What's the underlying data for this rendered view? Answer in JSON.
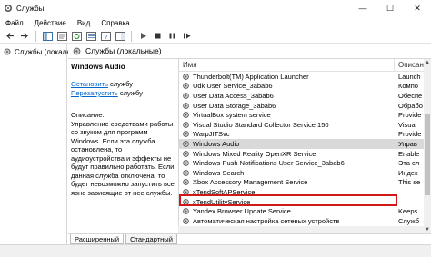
{
  "window": {
    "title": "Службы",
    "minimize": "—",
    "maximize": "☐",
    "close": "✕"
  },
  "menu": [
    "Файл",
    "Действие",
    "Вид",
    "Справка"
  ],
  "tree": {
    "root_label": "Службы (локальны"
  },
  "header": {
    "title": "Службы (локальные)"
  },
  "detail": {
    "service_name": "Windows Audio",
    "stop_link": "Остановить",
    "stop_suffix": " службу",
    "restart_link": "Перезапустить",
    "restart_suffix": " службу",
    "desc_label": "Описание:",
    "desc_text": "Управление средствами работы со звуком для программ Windows. Если эта служба остановлена, то аудиоустройства и эффекты не будут правильно работать. Если данная служба отключена, то будет невозможно запустить все явно зависящие от нее службы."
  },
  "columns": {
    "name": "Имя",
    "desc": "Описан"
  },
  "rows": [
    {
      "name": "Thunderbolt(TM) Application Launcher",
      "desc": "Launch"
    },
    {
      "name": "Udk User Service_3abab6",
      "desc": "Компо"
    },
    {
      "name": "User Data Access_3abab6",
      "desc": "Обеспе"
    },
    {
      "name": "User Data Storage_3abab6",
      "desc": "Обрабо"
    },
    {
      "name": "VirtualBox system service",
      "desc": "Provide"
    },
    {
      "name": "Visual Studio Standard Collector Service 150",
      "desc": "Visual"
    },
    {
      "name": "WarpJITSvc",
      "desc": "Provide"
    },
    {
      "name": "Windows Audio",
      "desc": "Управ"
    },
    {
      "name": "Windows Mixed Reality OpenXR Service",
      "desc": "Enable"
    },
    {
      "name": "Windows Push Notifications User Service_3abab6",
      "desc": "Эта сл"
    },
    {
      "name": "Windows Search",
      "desc": "Индек"
    },
    {
      "name": "Xbox Accessory Management Service",
      "desc": "This se"
    },
    {
      "name": "xTendSoftAPService",
      "desc": ""
    },
    {
      "name": "xTendUtilityService",
      "desc": ""
    },
    {
      "name": "Yandex.Browser Update Service",
      "desc": "Keeps"
    },
    {
      "name": "Автоматическая настройка сетевых устройств",
      "desc": "Служб"
    }
  ],
  "selected_index": 7,
  "tabs": {
    "extended": "Расширенный",
    "standard": "Стандартный"
  },
  "colors": {
    "selection_outline": "#d01818",
    "link": "#0066cc"
  }
}
